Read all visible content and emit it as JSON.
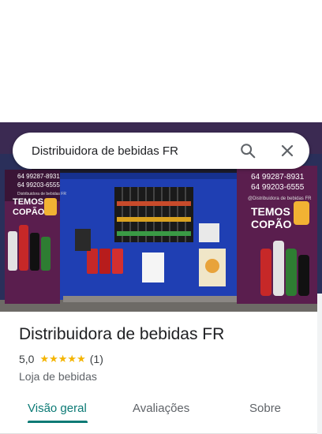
{
  "search": {
    "query": "Distribuidora de bebidas FR",
    "search_icon": "search-icon",
    "close_icon": "close-icon"
  },
  "photo": {
    "banner_left": {
      "phone1": "64 99287-8931",
      "phone2": "64 99203-6555",
      "handle": "Distribuidora de bebidas FR",
      "slogan_line1": "TEMOS",
      "slogan_line2": "COPÃO"
    },
    "banner_right": {
      "phone1": "64 99287-8931",
      "phone2": "64 99203-6555",
      "handle": "@Distribuidora de bebidas FR",
      "slogan_line1": "TEMOS",
      "slogan_line2": "COPÃO"
    }
  },
  "place": {
    "title": "Distribuidora de bebidas FR",
    "rating": "5,0",
    "stars": "★★★★★",
    "review_count": "(1)",
    "category": "Loja de bebidas"
  },
  "tabs": [
    {
      "label": "Visão geral",
      "active": true
    },
    {
      "label": "Avaliações",
      "active": false
    },
    {
      "label": "Sobre",
      "active": false
    }
  ],
  "colors": {
    "accent": "#0b7a75",
    "star": "#f4b400",
    "wall": "#1f3fb3"
  }
}
